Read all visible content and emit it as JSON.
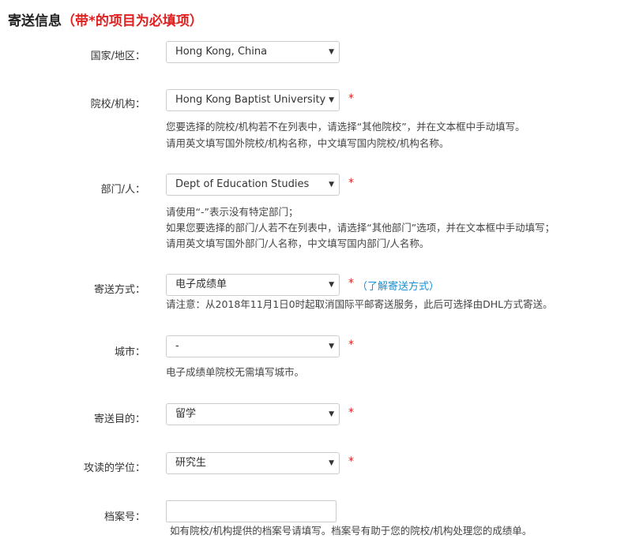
{
  "section": {
    "title": "寄送信息",
    "required_note": "（带*的项目为必填项）"
  },
  "required_mark": "*",
  "fields": {
    "country": {
      "label": "国家/地区：",
      "value": "Hong Kong, China"
    },
    "institution": {
      "label": "院校/机构：",
      "value": "Hong Kong Baptist University",
      "hints": [
        "您要选择的院校/机构若不在列表中，请选择“其他院校”，并在文本框中手动填写。",
        "请用英文填写国外院校/机构名称，中文填写国内院校/机构名称。"
      ]
    },
    "department": {
      "label": "部门/人：",
      "value": "Dept of Education Studies",
      "hints": [
        "请使用“-”表示没有特定部门；",
        "如果您要选择的部门/人若不在列表中，请选择“其他部门”选项，并在文本框中手动填写；",
        "请用英文填写国外部门/人名称，中文填写国内部门/人名称。"
      ]
    },
    "delivery": {
      "label": "寄送方式：",
      "value": "电子成绩单",
      "link": "（了解寄送方式）",
      "hints": [
        "请注意：从2018年11月1日0时起取消国际平邮寄送服务，此后可选择由DHL方式寄送。"
      ]
    },
    "city": {
      "label": "城市：",
      "value": "-",
      "hints": [
        "电子成绩单院校无需填写城市。"
      ]
    },
    "purpose": {
      "label": "寄送目的：",
      "value": "留学"
    },
    "degree": {
      "label": "攻读的学位：",
      "value": "研究生"
    },
    "file_number": {
      "label": "档案号：",
      "value": "",
      "hints": [
        "如有院校/机构提供的档案号请填写。档案号有助于您的院校/机构处理您的成绩单。"
      ]
    }
  },
  "icons": {
    "dropdown": "chevron-down-icon"
  }
}
